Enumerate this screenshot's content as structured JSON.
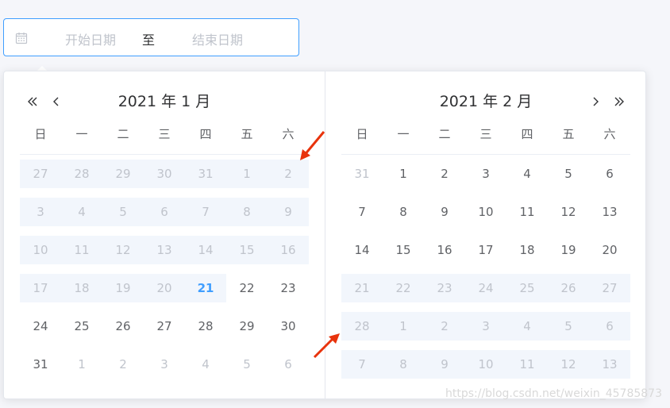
{
  "input": {
    "start_placeholder": "开始日期",
    "separator": "至",
    "end_placeholder": "结束日期",
    "icon": "calendar-icon"
  },
  "left": {
    "title": "2021 年 1 月",
    "weekdays": [
      "日",
      "一",
      "二",
      "三",
      "四",
      "五",
      "六"
    ],
    "rows": [
      [
        {
          "d": "27",
          "c": "muted range"
        },
        {
          "d": "28",
          "c": "muted range"
        },
        {
          "d": "29",
          "c": "muted range"
        },
        {
          "d": "30",
          "c": "muted range"
        },
        {
          "d": "31",
          "c": "muted range"
        },
        {
          "d": "1",
          "c": "muted range"
        },
        {
          "d": "2",
          "c": "muted range"
        }
      ],
      [
        {
          "d": "3",
          "c": "muted range"
        },
        {
          "d": "4",
          "c": "muted range"
        },
        {
          "d": "5",
          "c": "muted range"
        },
        {
          "d": "6",
          "c": "muted range"
        },
        {
          "d": "7",
          "c": "muted range"
        },
        {
          "d": "8",
          "c": "muted range"
        },
        {
          "d": "9",
          "c": "muted range"
        }
      ],
      [
        {
          "d": "10",
          "c": "muted range"
        },
        {
          "d": "11",
          "c": "muted range"
        },
        {
          "d": "12",
          "c": "muted range"
        },
        {
          "d": "13",
          "c": "muted range"
        },
        {
          "d": "14",
          "c": "muted range"
        },
        {
          "d": "15",
          "c": "muted range"
        },
        {
          "d": "16",
          "c": "muted range"
        }
      ],
      [
        {
          "d": "17",
          "c": "muted range"
        },
        {
          "d": "18",
          "c": "muted range"
        },
        {
          "d": "19",
          "c": "muted range"
        },
        {
          "d": "20",
          "c": "muted range"
        },
        {
          "d": "21",
          "c": "today range"
        },
        {
          "d": "22",
          "c": ""
        },
        {
          "d": "23",
          "c": ""
        }
      ],
      [
        {
          "d": "24",
          "c": ""
        },
        {
          "d": "25",
          "c": ""
        },
        {
          "d": "26",
          "c": ""
        },
        {
          "d": "27",
          "c": ""
        },
        {
          "d": "28",
          "c": ""
        },
        {
          "d": "29",
          "c": ""
        },
        {
          "d": "30",
          "c": ""
        }
      ],
      [
        {
          "d": "31",
          "c": ""
        },
        {
          "d": "1",
          "c": "muted"
        },
        {
          "d": "2",
          "c": "muted"
        },
        {
          "d": "3",
          "c": "muted"
        },
        {
          "d": "4",
          "c": "muted"
        },
        {
          "d": "5",
          "c": "muted"
        },
        {
          "d": "6",
          "c": "muted"
        }
      ]
    ]
  },
  "right": {
    "title": "2021 年 2 月",
    "weekdays": [
      "日",
      "一",
      "二",
      "三",
      "四",
      "五",
      "六"
    ],
    "rows": [
      [
        {
          "d": "31",
          "c": "muted"
        },
        {
          "d": "1",
          "c": ""
        },
        {
          "d": "2",
          "c": ""
        },
        {
          "d": "3",
          "c": ""
        },
        {
          "d": "4",
          "c": ""
        },
        {
          "d": "5",
          "c": ""
        },
        {
          "d": "6",
          "c": ""
        }
      ],
      [
        {
          "d": "7",
          "c": ""
        },
        {
          "d": "8",
          "c": ""
        },
        {
          "d": "9",
          "c": ""
        },
        {
          "d": "10",
          "c": ""
        },
        {
          "d": "11",
          "c": ""
        },
        {
          "d": "12",
          "c": ""
        },
        {
          "d": "13",
          "c": ""
        }
      ],
      [
        {
          "d": "14",
          "c": ""
        },
        {
          "d": "15",
          "c": ""
        },
        {
          "d": "16",
          "c": ""
        },
        {
          "d": "17",
          "c": ""
        },
        {
          "d": "18",
          "c": ""
        },
        {
          "d": "19",
          "c": ""
        },
        {
          "d": "20",
          "c": ""
        }
      ],
      [
        {
          "d": "21",
          "c": "muted range"
        },
        {
          "d": "22",
          "c": "muted range"
        },
        {
          "d": "23",
          "c": "muted range"
        },
        {
          "d": "24",
          "c": "muted range"
        },
        {
          "d": "25",
          "c": "muted range"
        },
        {
          "d": "26",
          "c": "muted range"
        },
        {
          "d": "27",
          "c": "muted range"
        }
      ],
      [
        {
          "d": "28",
          "c": "muted range"
        },
        {
          "d": "1",
          "c": "muted range"
        },
        {
          "d": "2",
          "c": "muted range"
        },
        {
          "d": "3",
          "c": "muted range"
        },
        {
          "d": "4",
          "c": "muted range"
        },
        {
          "d": "5",
          "c": "muted range"
        },
        {
          "d": "6",
          "c": "muted range"
        }
      ],
      [
        {
          "d": "7",
          "c": "muted range"
        },
        {
          "d": "8",
          "c": "muted range"
        },
        {
          "d": "9",
          "c": "muted range"
        },
        {
          "d": "10",
          "c": "muted range"
        },
        {
          "d": "11",
          "c": "muted range"
        },
        {
          "d": "12",
          "c": "muted range"
        },
        {
          "d": "13",
          "c": "muted range"
        }
      ]
    ]
  },
  "nav": {
    "prev_year_icon": "double-chevron-left-icon",
    "prev_month_icon": "chevron-left-icon",
    "next_month_icon": "chevron-right-icon",
    "next_year_icon": "double-chevron-right-icon"
  },
  "annotations": {
    "arrow_color": "#e8330c",
    "arrow_icons": [
      "red-arrow-icon",
      "red-arrow-icon"
    ]
  },
  "colors": {
    "accent": "#409eff",
    "range_bg": "#f2f6fc",
    "muted_text": "#c0c4cc",
    "text": "#606266"
  },
  "watermark": "https://blog.csdn.net/weixin_45785873"
}
